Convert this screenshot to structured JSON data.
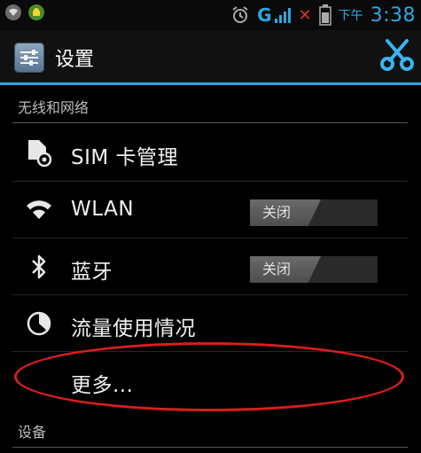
{
  "status_bar": {
    "network": "G",
    "ampm": "下午",
    "time": "3:38",
    "icons": [
      "wifi-icon",
      "android-icon",
      "alarm-icon",
      "signal-icon",
      "no-sim-icon",
      "battery-icon"
    ]
  },
  "action_bar": {
    "title": "设置",
    "app_icon": "settings-icon",
    "tool_icon": "scissors-icon"
  },
  "sections": {
    "wireless": "无线和网络",
    "device": "设备"
  },
  "items": {
    "sim": {
      "label": "SIM 卡管理",
      "icon": "sim-card-icon"
    },
    "wlan": {
      "label": "WLAN",
      "icon": "wifi-icon",
      "toggle": "关闭"
    },
    "bluetooth": {
      "label": "蓝牙",
      "icon": "bluetooth-icon",
      "toggle": "关闭"
    },
    "data_usage": {
      "label": "流量使用情况",
      "icon": "data-usage-icon"
    },
    "more": {
      "label": "更多..."
    }
  },
  "colors": {
    "accent": "#2ba8e0",
    "annotation": "#d81e1e",
    "background": "#000000"
  }
}
